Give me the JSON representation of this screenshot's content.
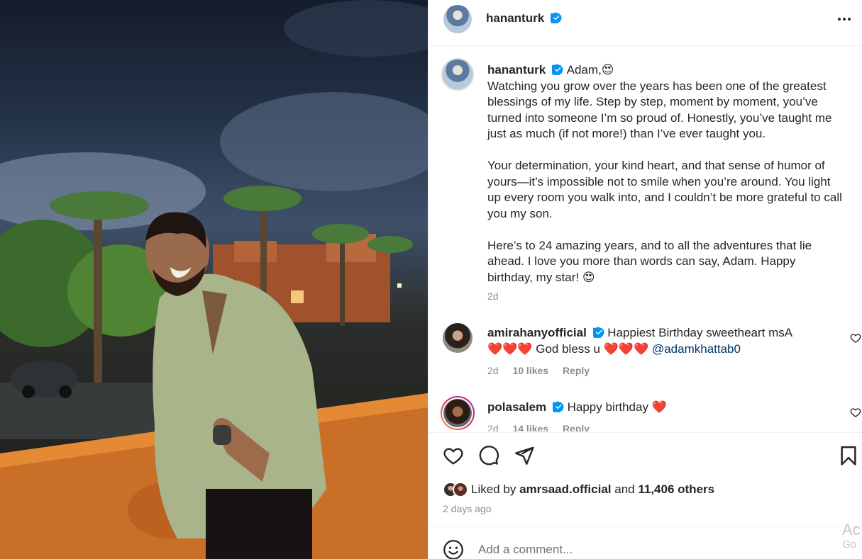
{
  "post": {
    "author": "hananturk",
    "verified": true,
    "caption": {
      "greeting": "Adam,",
      "greeting_emoji": "😍",
      "paragraphs": [
        "Watching you grow over the years has been one of the greatest blessings of my life. Step by step, moment by moment, you’ve turned into someone I’m so proud of. Honestly, you’ve taught me just as much (if not more!) than I’ve ever taught you.",
        "Your determination, your kind heart, and that sense of humor of yours—it’s impossible not to smile when you’re around. You light up every room you walk into, and I couldn’t be more grateful to call you my son.",
        "Here’s to 24 amazing years, and to all the adventures that lie ahead. I love you more than words can say, Adam. Happy birthday, my star! 😍"
      ],
      "time": "2d"
    },
    "comments": [
      {
        "username": "amirahanyofficial",
        "verified": true,
        "text_line1": "Happiest Birthday sweetheart msA",
        "hearts1": "❤️❤️❤️",
        "text_line2": "God bless u",
        "hearts2": "❤️❤️❤️",
        "mention": "@adamkhattab0",
        "time": "2d",
        "likes": "10 likes",
        "reply": "Reply"
      },
      {
        "username": "polasalem",
        "verified": true,
        "text": "Happy birthday",
        "heart": "❤️",
        "time": "2d",
        "likes": "14 likes",
        "reply": "Reply"
      }
    ],
    "liked_by_prefix": "Liked by",
    "liked_by_user": "amrsaad.official",
    "liked_by_and": "and",
    "liked_by_others": "11,406 others",
    "date": "2 days ago",
    "comment_placeholder": "Add a comment...",
    "watermark_line1": "Ac",
    "watermark_line2": "Go"
  },
  "icons": {
    "more": "more-horizontal-icon",
    "like": "heart-icon",
    "comment": "comment-icon",
    "share": "share-icon",
    "save": "bookmark-icon",
    "emoji": "emoji-icon",
    "verified": "verified-badge-icon"
  },
  "colors": {
    "verified_blue": "#0095f6",
    "mention_blue": "#00376b",
    "secondary_text": "#8e8e8e",
    "heart_red": "#ed4956"
  }
}
